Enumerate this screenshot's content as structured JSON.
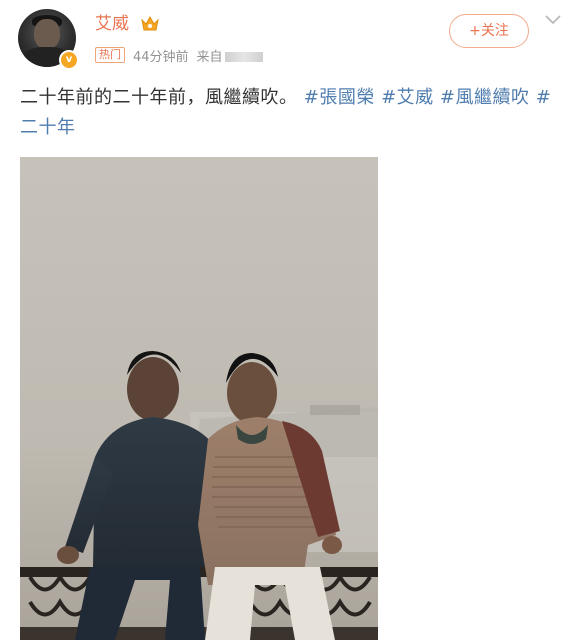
{
  "user": {
    "name": "艾威",
    "hot_tag": "热门",
    "time": "44分钟前",
    "source_prefix": "来自"
  },
  "follow_label": "+关注",
  "post": {
    "text": "二十年前的二十年前，風繼續吹。",
    "topics": [
      "#張國榮",
      "#艾威",
      "#風繼續吹",
      "#二十年"
    ]
  },
  "colors": {
    "brand_orange": "#eb7350",
    "topic_blue": "#507daf",
    "meta_gray": "#939393"
  },
  "icons": {
    "verified": "verified-badge-icon",
    "crown": "crown-icon",
    "more": "chevron-down-icon"
  }
}
